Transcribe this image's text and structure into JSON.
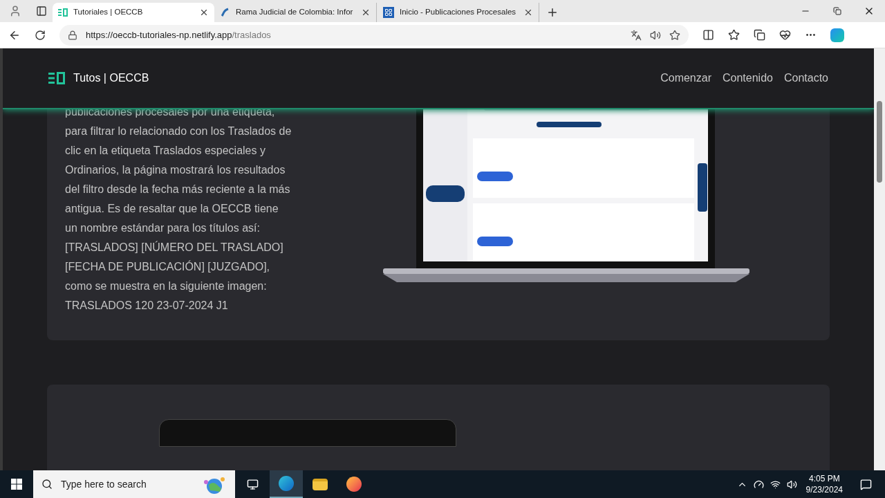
{
  "browser": {
    "tabs": [
      {
        "title": "Tutoriales | OECCB",
        "selected": true,
        "kind": "brand"
      },
      {
        "title": "Rama Judicial de Colombia: Infor",
        "selected": false,
        "kind": "scale"
      },
      {
        "title": "Inicio - Publicaciones Procesales",
        "selected": false,
        "kind": "grid"
      }
    ],
    "url_host": "https://oeccb-tutoriales-np.netlify.app",
    "url_path": "/traslados"
  },
  "navbar": {
    "brand": "Tutos | OECCB",
    "links": [
      {
        "label": "Comenzar"
      },
      {
        "label": "Contenido"
      },
      {
        "label": "Contacto"
      }
    ]
  },
  "article": {
    "paragraph": "publicaciones procesales por una etiqueta, para filtrar lo relacionado con los Traslados de clic en la etiqueta Traslados especiales y Ordinarios, la página mostrará los resultados del filtro desde la fecha más reciente a la más antigua. Es de resaltar que la OECCB tiene un nombre estándar para los títulos así: [TRASLADOS] [NÚMERO DEL TRASLADO] [FECHA DE PUBLICACIÓN] [JUZGADO], como se muestra en la siguiente imagen: TRASLADOS 120 23-07-2024 J1"
  },
  "taskbar": {
    "search_placeholder": "Type here to search",
    "time": "4:05 PM",
    "date": "9/23/2024"
  }
}
